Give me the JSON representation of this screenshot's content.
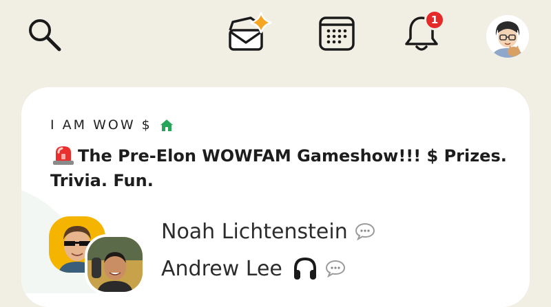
{
  "topbar": {
    "search_icon": "search-icon",
    "invite_icon": "envelope-sparkle-icon",
    "calendar_icon": "calendar-icon",
    "notifications_icon": "bell-icon",
    "notification_count": "1",
    "profile_avatar": "user-avatar",
    "colors": {
      "badge": "#e52a2a",
      "sparkle": "#f5a623",
      "icon": "#1a1a1a"
    }
  },
  "room": {
    "club_name": "I AM WOW $",
    "club_home_icon": "house-icon",
    "title": "The Pre-Elon WOWFAM Gameshow!!! $ Prizes. Trivia. Fun.",
    "title_emoji": "police-siren-icon",
    "speakers": [
      {
        "name": "Noah Lichtenstein",
        "status_icon": "chat-bubble-icon"
      },
      {
        "name": "Andrew Lee",
        "status_icon": "headphones-icon",
        "extra_icon": "chat-bubble-icon"
      }
    ],
    "colors": {
      "card": "#ffffff",
      "background": "#f1efe4",
      "home_green": "#27a55a"
    }
  }
}
